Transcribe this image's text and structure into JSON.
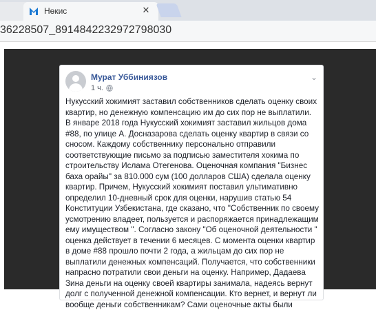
{
  "browser": {
    "tabs": [
      {
        "title": ""
      },
      {
        "title": "Нөкис"
      }
    ],
    "new_tab_label": "",
    "url": "36228507_8914842232972798030"
  },
  "post": {
    "author": "Мурат Уббиниязов",
    "time": "1 ч.",
    "paragraphs": [
      "Нукусский хокимият заставил собственников сделать оценку своих квартир, но денежную компенсацию им до сих пор не выплатили.",
      "В январе 2018 года Нукусский хокимият заставил жильцов дома #88, по улице А. Досназарова сделать оценку квартир в связи со сносом. Каждому собственнику персонально отправили соответствующие письмо за подписью заместителя хокима по строительству Ислама Отегенова. Оценочная компания \"Бизнес баха орайы\" за 810.000 сум (100 долларов США) сделала оценку квартир. Причем, Нукусский хокимият поставил ультимативно определил 10-дневный срок для оценки, нарушив статью 54 Конституции Узбекистана, где сказано, что \"Собственник по своему усмотрению владеет, пользуется и распоряжается принадлежащим ему имуществом \". Согласно закону \"Об оценочной деятельности \" оценка действует в течении 6 месяцев. С момента оценки квартир в доме #88 прошло почти 2 года, а жильцам до сих пор не выплатили денежных компенсаций. Получается, что собственники напрасно потратили свои деньги на оценку. Например, Дадаева Зина деньги на оценку своей квартиры занимала, надеясь вернут долг с полученной денежной компенсации. Кто вернет, и вернут ли вообще деньги собственникам? Сами оценочные акты были"
    ]
  }
}
